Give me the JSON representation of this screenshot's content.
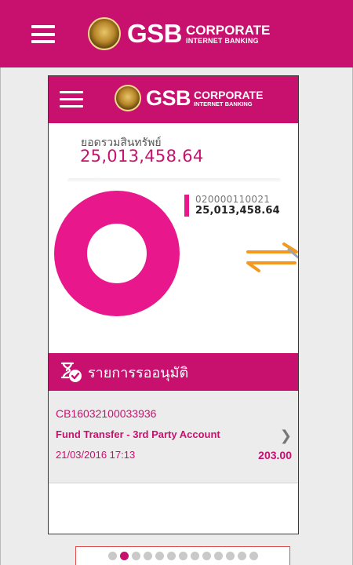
{
  "app": {
    "brand": "GSB",
    "brand_line1": "CORPORATE",
    "brand_line2": "INTERNET BANKING",
    "accent_color": "#c8106f"
  },
  "icons": {
    "menu": "hamburger-menu-icon",
    "logo_seal": "gsb-seal-logo",
    "swap": "swap-arrows-icon",
    "pending": "hourglass-check-icon",
    "chevron": "chevron-right-icon"
  },
  "summary": {
    "total_label": "ยอดรวมสินทรัพย์",
    "total_value": "25,013,458.64"
  },
  "chart_data": {
    "type": "pie",
    "categories": [
      "020000110021"
    ],
    "values": [
      25013458.64
    ],
    "legend": [
      {
        "account": "020000110021",
        "amount": "25,013,458.64",
        "color": "#e8188c"
      }
    ]
  },
  "pending": {
    "title": "รายการรออนุมัติ",
    "items": [
      {
        "ref": "CB16032100033936",
        "type": "Fund Transfer - 3rd Party Account",
        "datetime": "21/03/2016 17:13",
        "amount": "203.00"
      }
    ]
  },
  "pager": {
    "total_pages": 13,
    "active_index": 1
  }
}
